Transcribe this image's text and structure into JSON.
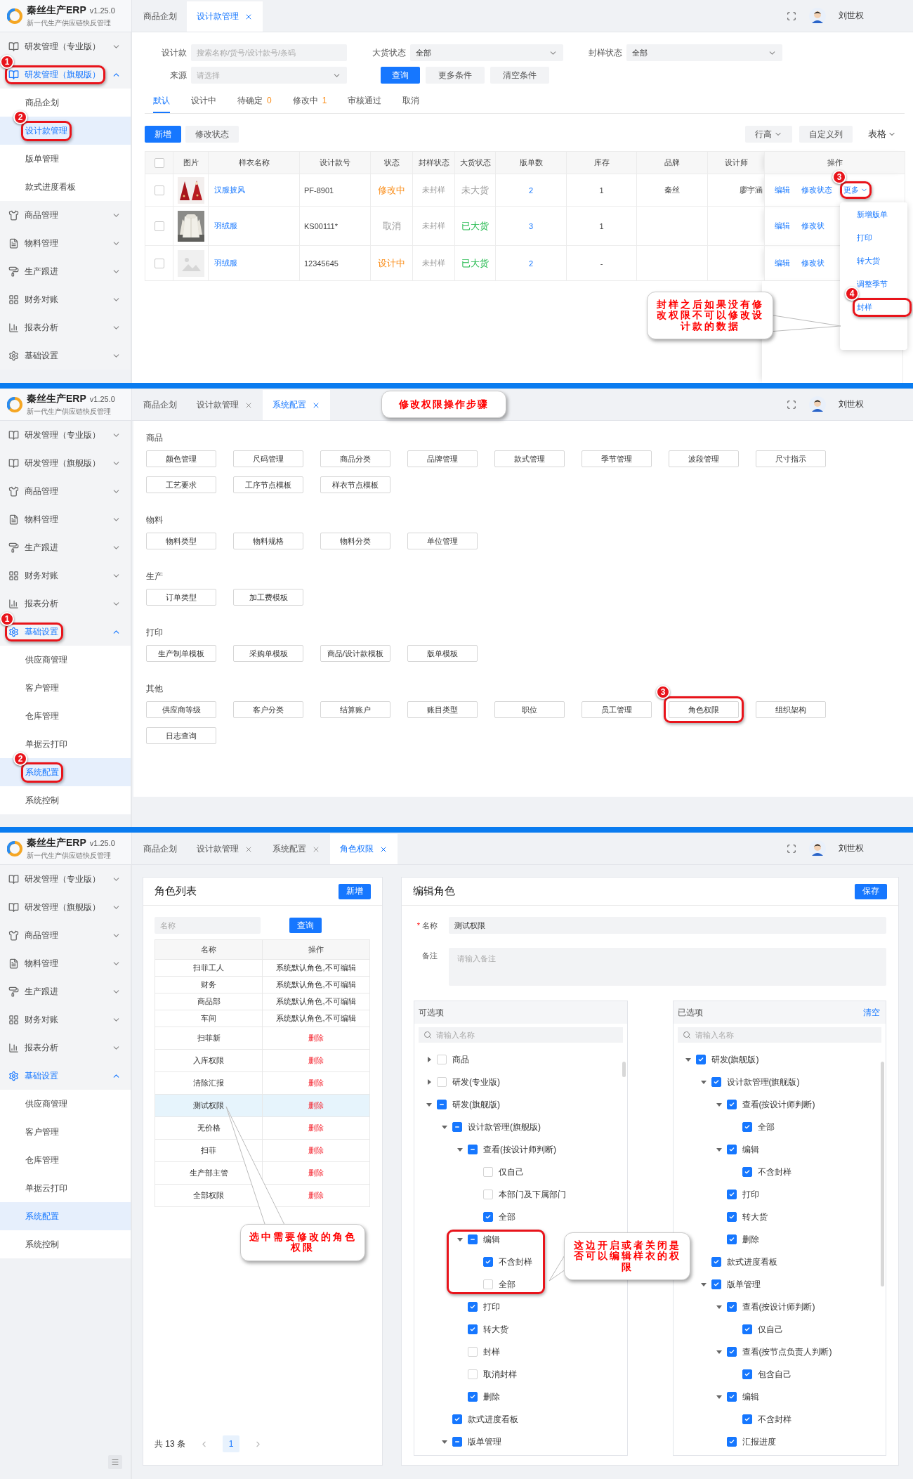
{
  "panels": [
    {
      "kind": "design_list",
      "brand": {
        "name": "秦丝生产ERP",
        "version": "v1.25.0",
        "tagline": "新一代生产供应链快反管理"
      },
      "user": {
        "name": "刘世权"
      },
      "tabs": [
        {
          "label": "商品企划",
          "closable": false,
          "selected": false
        },
        {
          "label": "设计款管理",
          "closable": true,
          "selected": true
        }
      ],
      "sidebar": [
        {
          "label": "研发管理（专业版）",
          "expanded": false
        },
        {
          "label": "研发管理（旗舰版）",
          "expanded": true,
          "step": "1",
          "children": [
            {
              "label": "商品企划",
              "selected": false
            },
            {
              "label": "设计款管理",
              "selected": true,
              "step": "2"
            },
            {
              "label": "版单管理",
              "selected": false
            },
            {
              "label": "款式进度看板",
              "selected": false
            }
          ]
        },
        {
          "label": "商品管理",
          "expanded": false
        },
        {
          "label": "物料管理",
          "expanded": false
        },
        {
          "label": "生产跟进",
          "expanded": false
        },
        {
          "label": "财务对账",
          "expanded": false
        },
        {
          "label": "报表分析",
          "expanded": false
        },
        {
          "label": "基础设置",
          "expanded": false
        }
      ],
      "filters": [
        {
          "label": "设计款",
          "kind": "search",
          "placeholder": "搜索名称/货号/设计款号/条码"
        },
        {
          "label": "大货状态",
          "kind": "select",
          "value": "全部"
        },
        {
          "label": "封样状态",
          "kind": "select",
          "value": "全部"
        },
        {
          "label": "来源",
          "kind": "select",
          "placeholder": "请选择"
        }
      ],
      "filter_buttons": [
        {
          "label": "查询",
          "primary": true
        },
        {
          "label": "更多条件",
          "primary": false
        },
        {
          "label": "清空条件",
          "primary": false
        }
      ],
      "status_tabs": [
        {
          "label": "默认",
          "selected": true
        },
        {
          "label": "设计中",
          "selected": false
        },
        {
          "label": "待确定",
          "count": "0",
          "selected": false
        },
        {
          "label": "修改中",
          "count": "1",
          "selected": false
        },
        {
          "label": "审核通过",
          "selected": false
        },
        {
          "label": "取消",
          "selected": false
        }
      ],
      "actions": [
        {
          "label": "新增",
          "primary": true
        },
        {
          "label": "修改状态",
          "primary": false
        }
      ],
      "view_buttons": [
        {
          "label": "行高",
          "kind": "button",
          "caret": true
        },
        {
          "label": "自定义列",
          "kind": "button",
          "caret": false
        },
        {
          "label": "表格",
          "kind": "text",
          "caret": true
        }
      ],
      "table": {
        "all_checked": false,
        "columns": [
          "图片",
          "样衣名称",
          "设计款号",
          "状态",
          "封样状态",
          "大货状态",
          "版单数",
          "库存",
          "品牌",
          "设计师",
          "操作"
        ],
        "rows": [
          {
            "checked": false,
            "thumbnail": {
              "kind": "picture"
            },
            "name": "汉服披风",
            "code": "PF-8901",
            "status": {
              "text": "修改中",
              "color": "#fa8c16"
            },
            "seal": "未封样",
            "bulk": {
              "text": "未大货",
              "color": "#999999"
            },
            "versions": "2",
            "stock": "1",
            "brand": "秦丝",
            "designer": "廖宇涵",
            "actions": [
              {
                "label": "编辑",
                "caret": false
              },
              {
                "label": "修改状态",
                "caret": false
              },
              {
                "label": "更多",
                "caret": true,
                "step": "3"
              }
            ]
          },
          {
            "checked": false,
            "thumbnail": {
              "kind": "picture"
            },
            "name": "羽绒服",
            "code": "KS00111*",
            "status": {
              "text": "取消",
              "color": "#999999"
            },
            "seal": "未封样",
            "bulk": {
              "text": "已大货",
              "color": "#1fb84a"
            },
            "versions": "3",
            "stock": "1",
            "brand": "",
            "designer": "",
            "actions": [
              {
                "label": "编辑",
                "caret": false
              },
              {
                "label": "修改状",
                "caret": false
              }
            ]
          },
          {
            "checked": false,
            "thumbnail": {
              "kind": "placeholder"
            },
            "name": "羽绒服",
            "code": "12345645",
            "status": {
              "text": "设计中",
              "color": "#fa8c16"
            },
            "seal": "未封样",
            "bulk": {
              "text": "已大货",
              "color": "#1fb84a"
            },
            "versions": "2",
            "stock": "-",
            "brand": "",
            "designer": "",
            "actions": [
              {
                "label": "编辑",
                "caret": false
              },
              {
                "label": "修改状",
                "caret": false
              }
            ]
          }
        ]
      },
      "menu": [
        {
          "label": "新增版单"
        },
        {
          "label": "打印"
        },
        {
          "label": "转大货"
        },
        {
          "label": "调整季节"
        },
        {
          "label": "封样",
          "step": "4"
        }
      ],
      "callouts": [
        {
          "text": "封样之后如果没有修改权限不可以修改设计款的数据"
        }
      ]
    },
    {
      "kind": "config",
      "brand": {
        "name": "秦丝生产ERP",
        "version": "v1.25.0",
        "tagline": "新一代生产供应链快反管理"
      },
      "user": {
        "name": "刘世权"
      },
      "tabs": [
        {
          "label": "商品企划",
          "closable": false,
          "selected": false
        },
        {
          "label": "设计款管理",
          "closable": true,
          "selected": false
        },
        {
          "label": "系统配置",
          "closable": true,
          "selected": true
        }
      ],
      "sidebar": [
        {
          "label": "研发管理（专业版）",
          "expanded": false
        },
        {
          "label": "研发管理（旗舰版）",
          "expanded": false
        },
        {
          "label": "商品管理",
          "expanded": false
        },
        {
          "label": "物料管理",
          "expanded": false
        },
        {
          "label": "生产跟进",
          "expanded": false
        },
        {
          "label": "财务对账",
          "expanded": false
        },
        {
          "label": "报表分析",
          "expanded": false
        },
        {
          "label": "基础设置",
          "expanded": true,
          "step": "1",
          "children": [
            {
              "label": "供应商管理",
              "selected": false
            },
            {
              "label": "客户管理",
              "selected": false
            },
            {
              "label": "仓库管理",
              "selected": false
            },
            {
              "label": "单据云打印",
              "selected": false
            },
            {
              "label": "系统配置",
              "selected": true,
              "step": "2"
            },
            {
              "label": "系统控制",
              "selected": false
            }
          ]
        }
      ],
      "sections": [
        {
          "title": "商品",
          "buttons": [
            {
              "label": "颜色管理"
            },
            {
              "label": "尺码管理"
            },
            {
              "label": "商品分类"
            },
            {
              "label": "品牌管理"
            },
            {
              "label": "款式管理"
            },
            {
              "label": "季节管理"
            },
            {
              "label": "波段管理"
            },
            {
              "label": "尺寸指示"
            },
            {
              "label": "工艺要求"
            },
            {
              "label": "工序节点模板"
            },
            {
              "label": "样衣节点模板"
            }
          ]
        },
        {
          "title": "物料",
          "buttons": [
            {
              "label": "物料类型"
            },
            {
              "label": "物料规格"
            },
            {
              "label": "物料分类"
            },
            {
              "label": "单位管理"
            }
          ]
        },
        {
          "title": "生产",
          "buttons": [
            {
              "label": "订单类型"
            },
            {
              "label": "加工费模板"
            }
          ]
        },
        {
          "title": "打印",
          "buttons": [
            {
              "label": "生产制单模板"
            },
            {
              "label": "采购单模板"
            },
            {
              "label": "商品/设计款模板"
            },
            {
              "label": "版单模板"
            }
          ]
        },
        {
          "title": "其他",
          "buttons": [
            {
              "label": "供应商等级"
            },
            {
              "label": "客户分类"
            },
            {
              "label": "结算账户"
            },
            {
              "label": "账目类型"
            },
            {
              "label": "职位"
            },
            {
              "label": "员工管理"
            },
            {
              "label": "角色权限",
              "step": "3"
            },
            {
              "label": "组织架构"
            },
            {
              "label": "日志查询"
            }
          ]
        }
      ],
      "callouts": [
        {
          "text": "修改权限操作步骤"
        }
      ]
    },
    {
      "kind": "roles",
      "brand": {
        "name": "秦丝生产ERP",
        "version": "v1.25.0",
        "tagline": "新一代生产供应链快反管理"
      },
      "user": {
        "name": "刘世权"
      },
      "tabs": [
        {
          "label": "商品企划",
          "closable": false,
          "selected": false
        },
        {
          "label": "设计款管理",
          "closable": true,
          "selected": false
        },
        {
          "label": "系统配置",
          "closable": true,
          "selected": false
        },
        {
          "label": "角色权限",
          "closable": true,
          "selected": true
        }
      ],
      "sidebar": [
        {
          "label": "研发管理（专业版）",
          "expanded": false
        },
        {
          "label": "研发管理（旗舰版）",
          "expanded": false
        },
        {
          "label": "商品管理",
          "expanded": false
        },
        {
          "label": "物料管理",
          "expanded": false
        },
        {
          "label": "生产跟进",
          "expanded": false
        },
        {
          "label": "财务对账",
          "expanded": false
        },
        {
          "label": "报表分析",
          "expanded": false
        },
        {
          "label": "基础设置",
          "expanded": true,
          "children": [
            {
              "label": "供应商管理",
              "selected": false
            },
            {
              "label": "客户管理",
              "selected": false
            },
            {
              "label": "仓库管理",
              "selected": false
            },
            {
              "label": "单据云打印",
              "selected": false
            },
            {
              "label": "系统配置",
              "selected": true
            },
            {
              "label": "系统控制",
              "selected": false
            }
          ]
        }
      ],
      "role_list": {
        "title": "角色列表",
        "add": "新增",
        "search_placeholder": "名称",
        "search_button": "查询",
        "columns": [
          "名称",
          "操作"
        ],
        "rows": [
          {
            "name": "扫菲工人",
            "action": "系统默认角色,不可编辑",
            "kind": "system",
            "selected": false
          },
          {
            "name": "财务",
            "action": "系统默认角色,不可编辑",
            "kind": "system",
            "selected": false
          },
          {
            "name": "商品部",
            "action": "系统默认角色,不可编辑",
            "kind": "system",
            "selected": false
          },
          {
            "name": "车间",
            "action": "系统默认角色,不可编辑",
            "kind": "system",
            "selected": false
          },
          {
            "name": "扫菲新",
            "action": "删除",
            "kind": "custom",
            "selected": false
          },
          {
            "name": "入库权限",
            "action": "删除",
            "kind": "custom",
            "selected": false
          },
          {
            "name": "清除汇报",
            "action": "删除",
            "kind": "custom",
            "selected": false
          },
          {
            "name": "测试权限",
            "action": "删除",
            "kind": "custom",
            "selected": true
          },
          {
            "name": "无价格",
            "action": "删除",
            "kind": "custom",
            "selected": false
          },
          {
            "name": "扫菲",
            "action": "删除",
            "kind": "custom",
            "selected": false
          },
          {
            "name": "生产部主管",
            "action": "删除",
            "kind": "custom",
            "selected": false
          },
          {
            "name": "全部权限",
            "action": "删除",
            "kind": "custom",
            "selected": false
          }
        ],
        "total": "共 13 条",
        "page": "1"
      },
      "editor": {
        "title": "编辑角色",
        "save": "保存",
        "fields": [
          {
            "label": "名称",
            "required": true,
            "required_mark": "*",
            "kind": "input",
            "value": "测试权限"
          },
          {
            "label": "备注",
            "kind": "textarea",
            "placeholder": "请输入备注"
          }
        ],
        "trees": [
          {
            "title": "可选项",
            "search_placeholder": "请输入名称",
            "nodes": [
              {
                "label": "商品",
                "kind": "branch",
                "expanded": false,
                "checked": false,
                "indeterminate": false
              },
              {
                "label": "研发(专业版)",
                "kind": "branch",
                "expanded": false,
                "checked": false,
                "indeterminate": false
              },
              {
                "label": "研发(旗舰版)",
                "kind": "branch",
                "expanded": true,
                "checked": false,
                "indeterminate": true,
                "children": [
                  {
                    "label": "设计款管理(旗舰版)",
                    "kind": "branch",
                    "expanded": true,
                    "checked": false,
                    "indeterminate": true,
                    "children": [
                      {
                        "label": "查看(按设计师判断)",
                        "kind": "branch",
                        "expanded": true,
                        "checked": false,
                        "indeterminate": true,
                        "children": [
                          {
                            "label": "仅自己",
                            "kind": "leaf",
                            "checked": false,
                            "indeterminate": false
                          },
                          {
                            "label": "本部门及下属部门",
                            "kind": "leaf",
                            "checked": false,
                            "indeterminate": false
                          },
                          {
                            "label": "全部",
                            "kind": "leaf",
                            "checked": true,
                            "indeterminate": false
                          }
                        ]
                      },
                      {
                        "label": "编辑",
                        "kind": "branch",
                        "expanded": true,
                        "checked": false,
                        "indeterminate": true,
                        "highlighted": true,
                        "children": [
                          {
                            "label": "不含封样",
                            "kind": "leaf",
                            "checked": true,
                            "indeterminate": false
                          },
                          {
                            "label": "全部",
                            "kind": "leaf",
                            "checked": false,
                            "indeterminate": false
                          }
                        ]
                      },
                      {
                        "label": "打印",
                        "kind": "leaf",
                        "checked": true,
                        "indeterminate": false
                      },
                      {
                        "label": "转大货",
                        "kind": "leaf",
                        "checked": true,
                        "indeterminate": false
                      },
                      {
                        "label": "封样",
                        "kind": "leaf",
                        "checked": false,
                        "indeterminate": false
                      },
                      {
                        "label": "取消封样",
                        "kind": "leaf",
                        "checked": false,
                        "indeterminate": false
                      },
                      {
                        "label": "删除",
                        "kind": "leaf",
                        "checked": true,
                        "indeterminate": false
                      }
                    ]
                  },
                  {
                    "label": "款式进度看板",
                    "kind": "leaf",
                    "checked": true,
                    "indeterminate": false
                  },
                  {
                    "label": "版单管理",
                    "kind": "branch",
                    "expanded": true,
                    "checked": false,
                    "indeterminate": true
                  }
                ]
              }
            ]
          },
          {
            "title": "已选项",
            "clear": "清空",
            "search_placeholder": "请输入名称",
            "nodes": [
              {
                "label": "研发(旗舰版)",
                "kind": "branch",
                "expanded": true,
                "checked": true,
                "indeterminate": false,
                "children": [
                  {
                    "label": "设计款管理(旗舰版)",
                    "kind": "branch",
                    "expanded": true,
                    "checked": true,
                    "indeterminate": false,
                    "children": [
                      {
                        "label": "查看(按设计师判断)",
                        "kind": "branch",
                        "expanded": true,
                        "checked": true,
                        "indeterminate": false,
                        "children": [
                          {
                            "label": "全部",
                            "kind": "leaf",
                            "checked": true,
                            "indeterminate": false
                          }
                        ]
                      },
                      {
                        "label": "编辑",
                        "kind": "branch",
                        "expanded": true,
                        "checked": true,
                        "indeterminate": false,
                        "children": [
                          {
                            "label": "不含封样",
                            "kind": "leaf",
                            "checked": true,
                            "indeterminate": false
                          }
                        ]
                      },
                      {
                        "label": "打印",
                        "kind": "leaf",
                        "checked": true,
                        "indeterminate": false
                      },
                      {
                        "label": "转大货",
                        "kind": "leaf",
                        "checked": true,
                        "indeterminate": false
                      },
                      {
                        "label": "删除",
                        "kind": "leaf",
                        "checked": true,
                        "indeterminate": false
                      }
                    ]
                  },
                  {
                    "label": "款式进度看板",
                    "kind": "leaf",
                    "checked": true,
                    "indeterminate": false
                  },
                  {
                    "label": "版单管理",
                    "kind": "branch",
                    "expanded": true,
                    "checked": true,
                    "indeterminate": false,
                    "children": [
                      {
                        "label": "查看(按设计师判断)",
                        "kind": "branch",
                        "expanded": true,
                        "checked": true,
                        "indeterminate": false,
                        "children": [
                          {
                            "label": "仅自己",
                            "kind": "leaf",
                            "checked": true,
                            "indeterminate": false
                          }
                        ]
                      },
                      {
                        "label": "查看(按节点负责人判断)",
                        "kind": "branch",
                        "expanded": true,
                        "checked": true,
                        "indeterminate": false,
                        "children": [
                          {
                            "label": "包含自己",
                            "kind": "leaf",
                            "checked": true,
                            "indeterminate": false
                          }
                        ]
                      },
                      {
                        "label": "编辑",
                        "kind": "branch",
                        "expanded": true,
                        "checked": true,
                        "indeterminate": false,
                        "children": [
                          {
                            "label": "不含封样",
                            "kind": "leaf",
                            "checked": true,
                            "indeterminate": false
                          }
                        ]
                      },
                      {
                        "label": "汇报进度",
                        "kind": "leaf",
                        "checked": true,
                        "indeterminate": false
                      }
                    ]
                  }
                ]
              }
            ]
          }
        ]
      },
      "callouts": [
        {
          "text": "选中需要修改的角色权限"
        },
        {
          "text": "这边开启或者关闭是否可以编辑样衣的权限"
        }
      ]
    }
  ]
}
